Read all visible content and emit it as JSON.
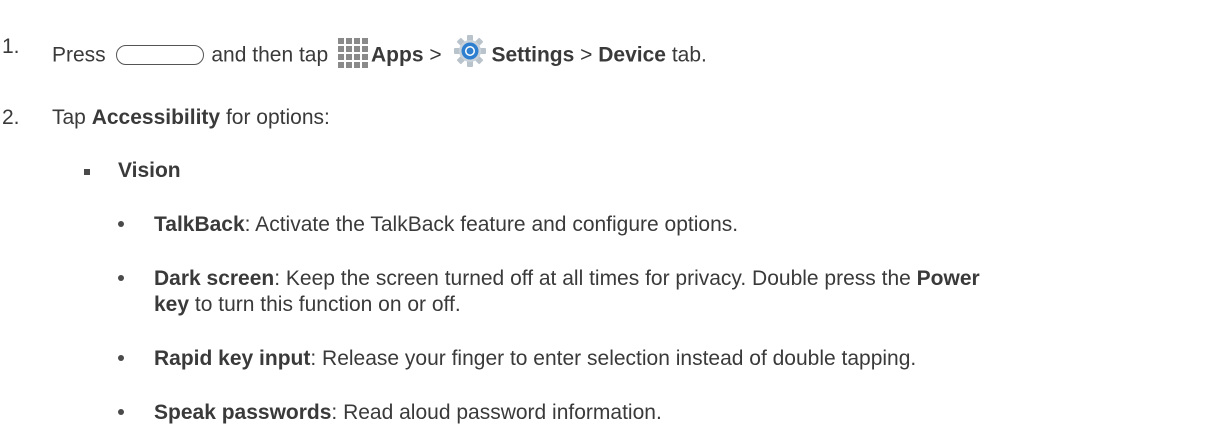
{
  "steps": [
    {
      "number": "1.",
      "text_press": "Press",
      "text_and_then_tap": "and then tap",
      "apps_label": "Apps",
      "separator1": ">",
      "settings_label": "Settings",
      "separator2": ">",
      "device_label": "Device",
      "tab_suffix": "tab."
    },
    {
      "number": "2.",
      "text_tap": "Tap",
      "accessibility_label": "Accessibility",
      "for_options": "for options:"
    }
  ],
  "section": {
    "title": "Vision"
  },
  "items": [
    {
      "term": "TalkBack",
      "description": ": Activate the TalkBack feature and configure options."
    },
    {
      "term": "Dark screen",
      "description_line1": ": Keep the screen turned off at all times for privacy. Double press the",
      "power_label": "Power",
      "key_label": "key",
      "description_line2": "to turn this function on or off."
    },
    {
      "term": "Rapid key input",
      "description": ": Release your finger to enter selection instead of double tapping."
    },
    {
      "term": "Speak passwords",
      "description": ": Read aloud password information."
    }
  ],
  "icons": {
    "home_button": "home-button-icon",
    "apps": "apps-grid-icon",
    "settings": "settings-gear-icon"
  },
  "colors": {
    "text": "#3a3a3a",
    "settings_blue": "#2f7fd0"
  }
}
